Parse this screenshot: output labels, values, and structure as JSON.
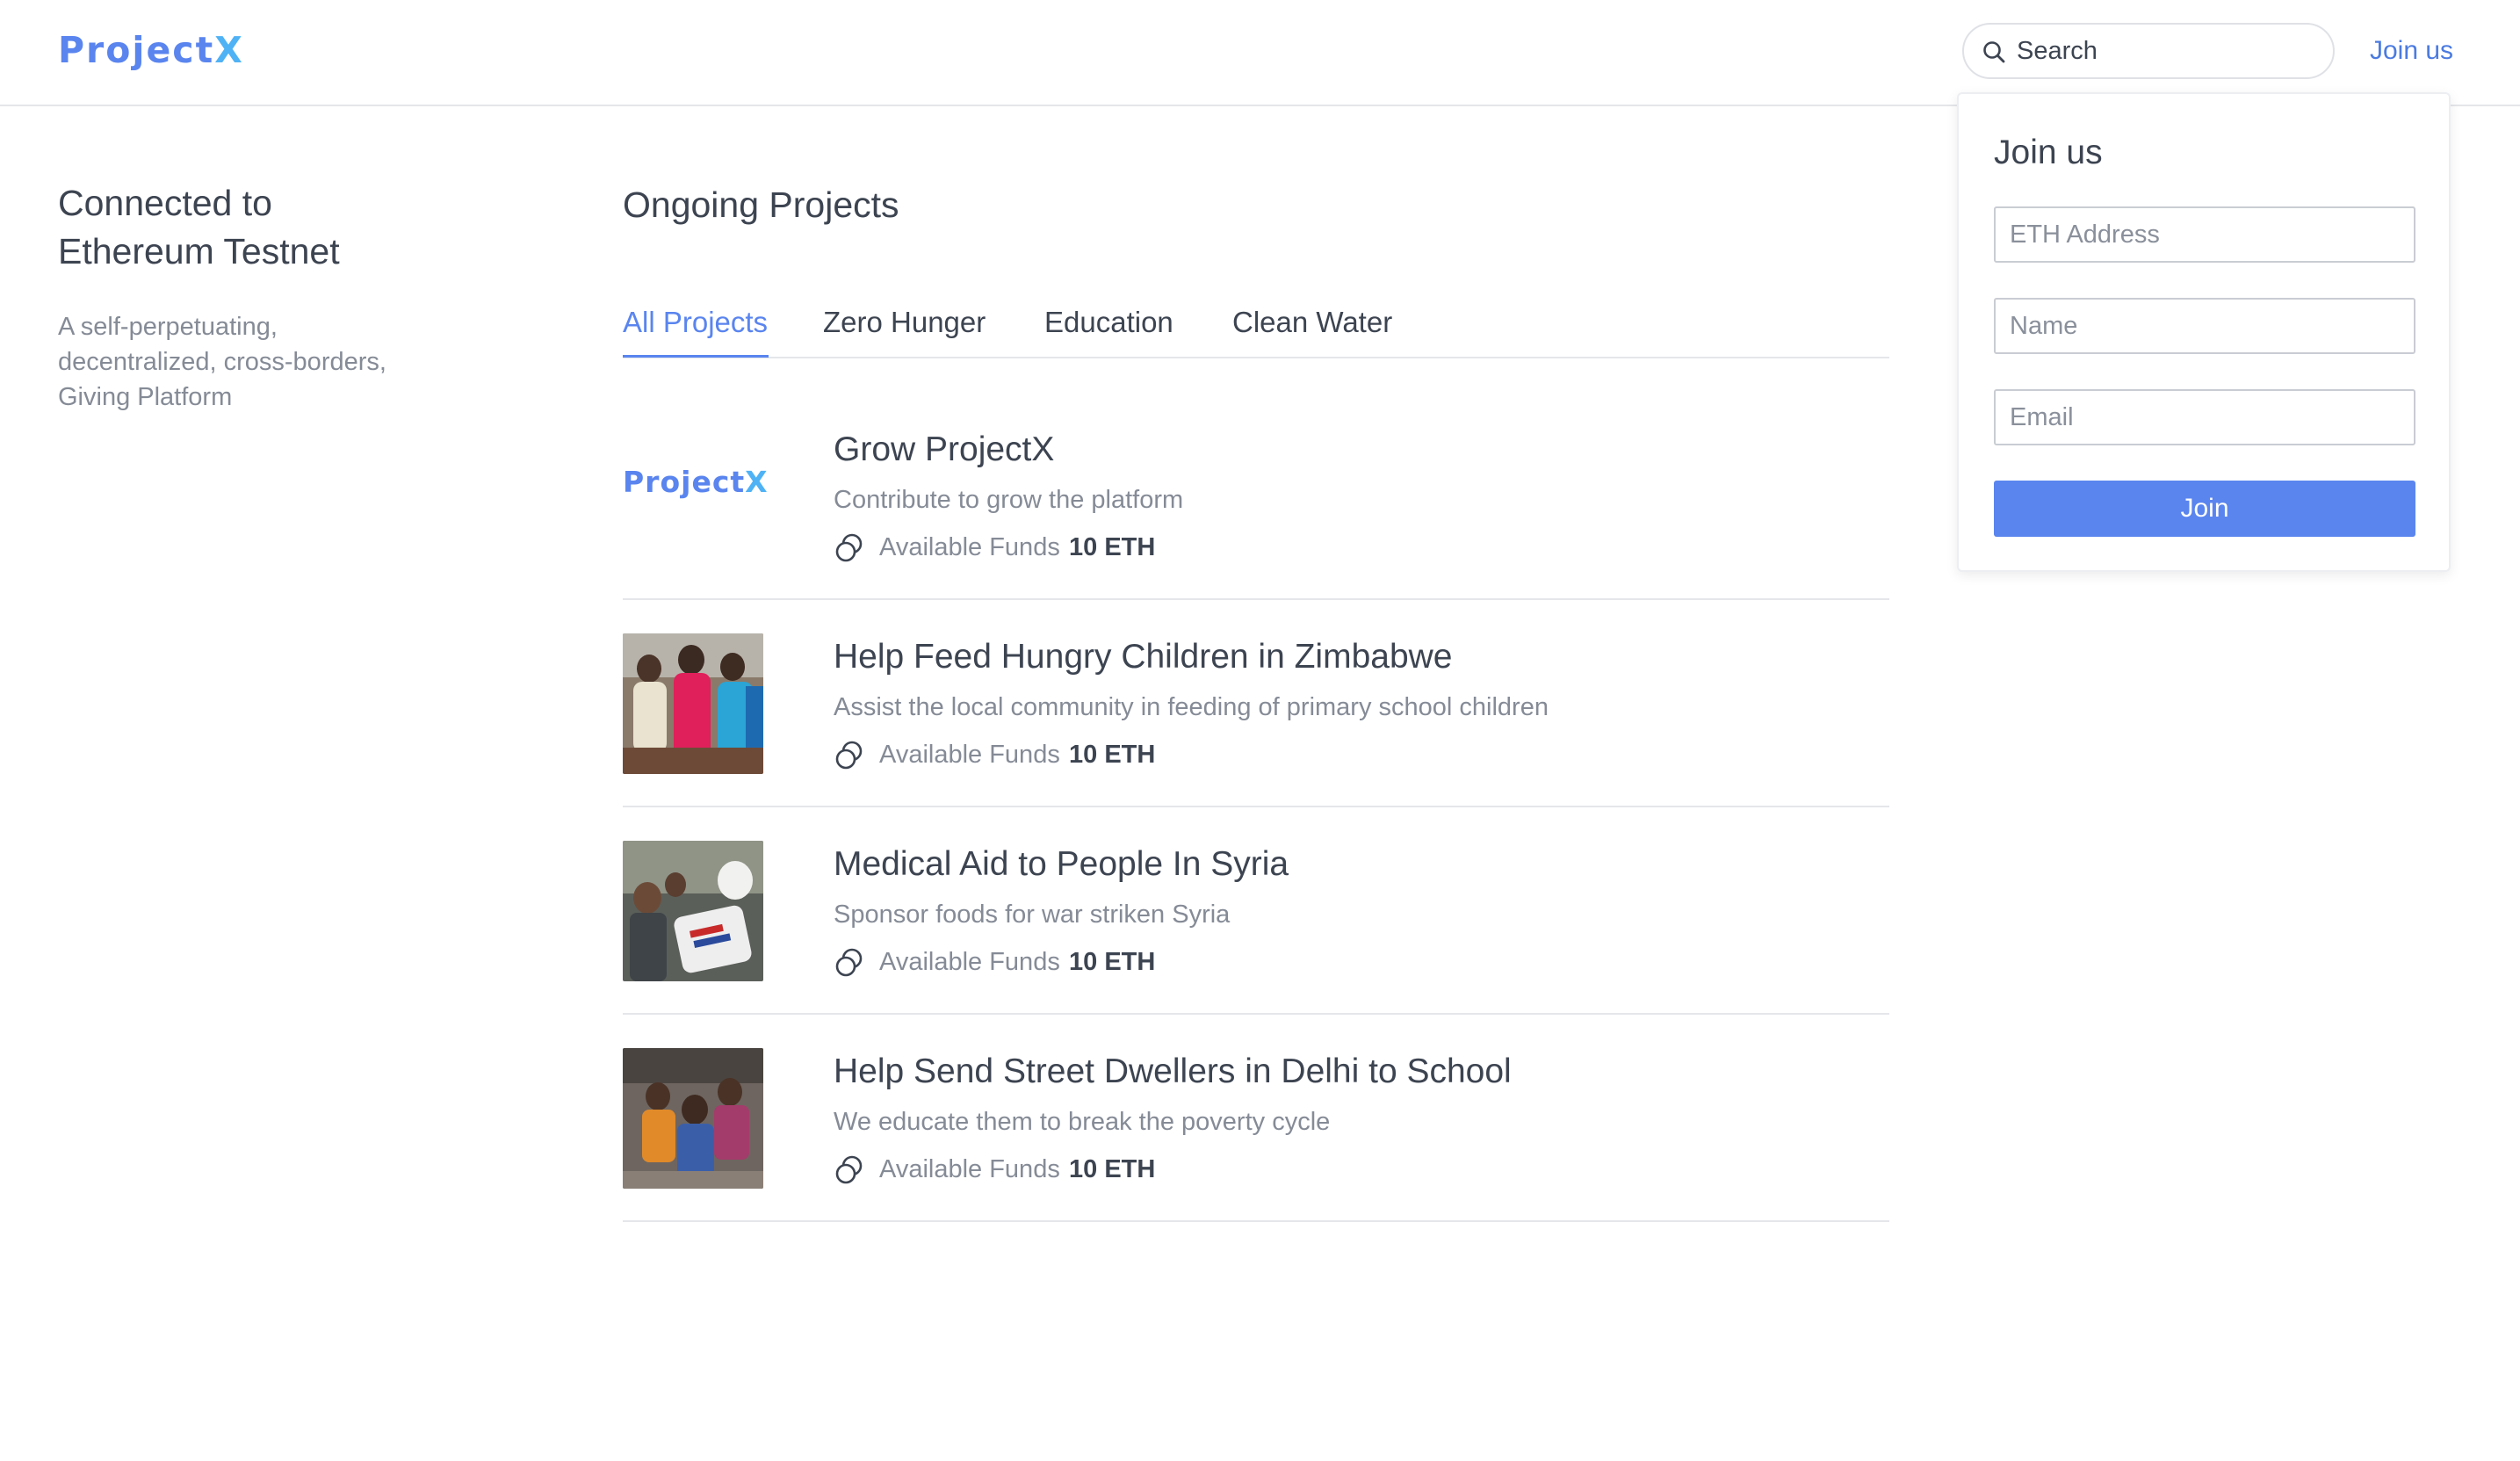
{
  "app": {
    "logo_part1": "Project",
    "logo_part2": "X"
  },
  "header": {
    "search_placeholder": "Search",
    "join_link": "Join us"
  },
  "sidebar": {
    "connected_line1": "Connected to",
    "connected_line2": "Ethereum Testnet",
    "tagline_line1": "A self-perpetuating,",
    "tagline_line2": "decentralized, cross-borders,",
    "tagline_line3": "Giving Platform"
  },
  "main": {
    "title": "Ongoing Projects",
    "tabs": [
      {
        "label": "All Projects",
        "active": true
      },
      {
        "label": "Zero Hunger",
        "active": false
      },
      {
        "label": "Education",
        "active": false
      },
      {
        "label": "Clean Water",
        "active": false
      }
    ],
    "projects": [
      {
        "title": "Grow ProjectX",
        "description": "Contribute to grow the platform",
        "funds_label": "Available Funds",
        "funds_value": "10 ETH",
        "thumb_logo_part1": "Project",
        "thumb_logo_part2": "X"
      },
      {
        "title": "Help Feed Hungry Children in Zimbabwe",
        "description": "Assist the local community in feeding of primary school children",
        "funds_label": "Available Funds",
        "funds_value": "10 ETH"
      },
      {
        "title": "Medical Aid to People In Syria",
        "description": "Sponsor foods for war striken Syria",
        "funds_label": "Available Funds",
        "funds_value": "10 ETH"
      },
      {
        "title": "Help Send Street Dwellers in Delhi to School",
        "description": "We educate them to break the poverty cycle",
        "funds_label": "Available Funds",
        "funds_value": "10 ETH"
      }
    ]
  },
  "join_dropdown": {
    "title": "Join us",
    "eth_placeholder": "ETH Address",
    "name_placeholder": "Name",
    "email_placeholder": "Email",
    "button_label": "Join"
  },
  "colors": {
    "accent": "#5a85ef",
    "logo_x": "#4fb2f5",
    "text": "#3d4451",
    "muted": "#858b96",
    "divider": "#e4e6ea"
  },
  "icons": {
    "search": "search-icon",
    "funds": "coins-icon"
  }
}
